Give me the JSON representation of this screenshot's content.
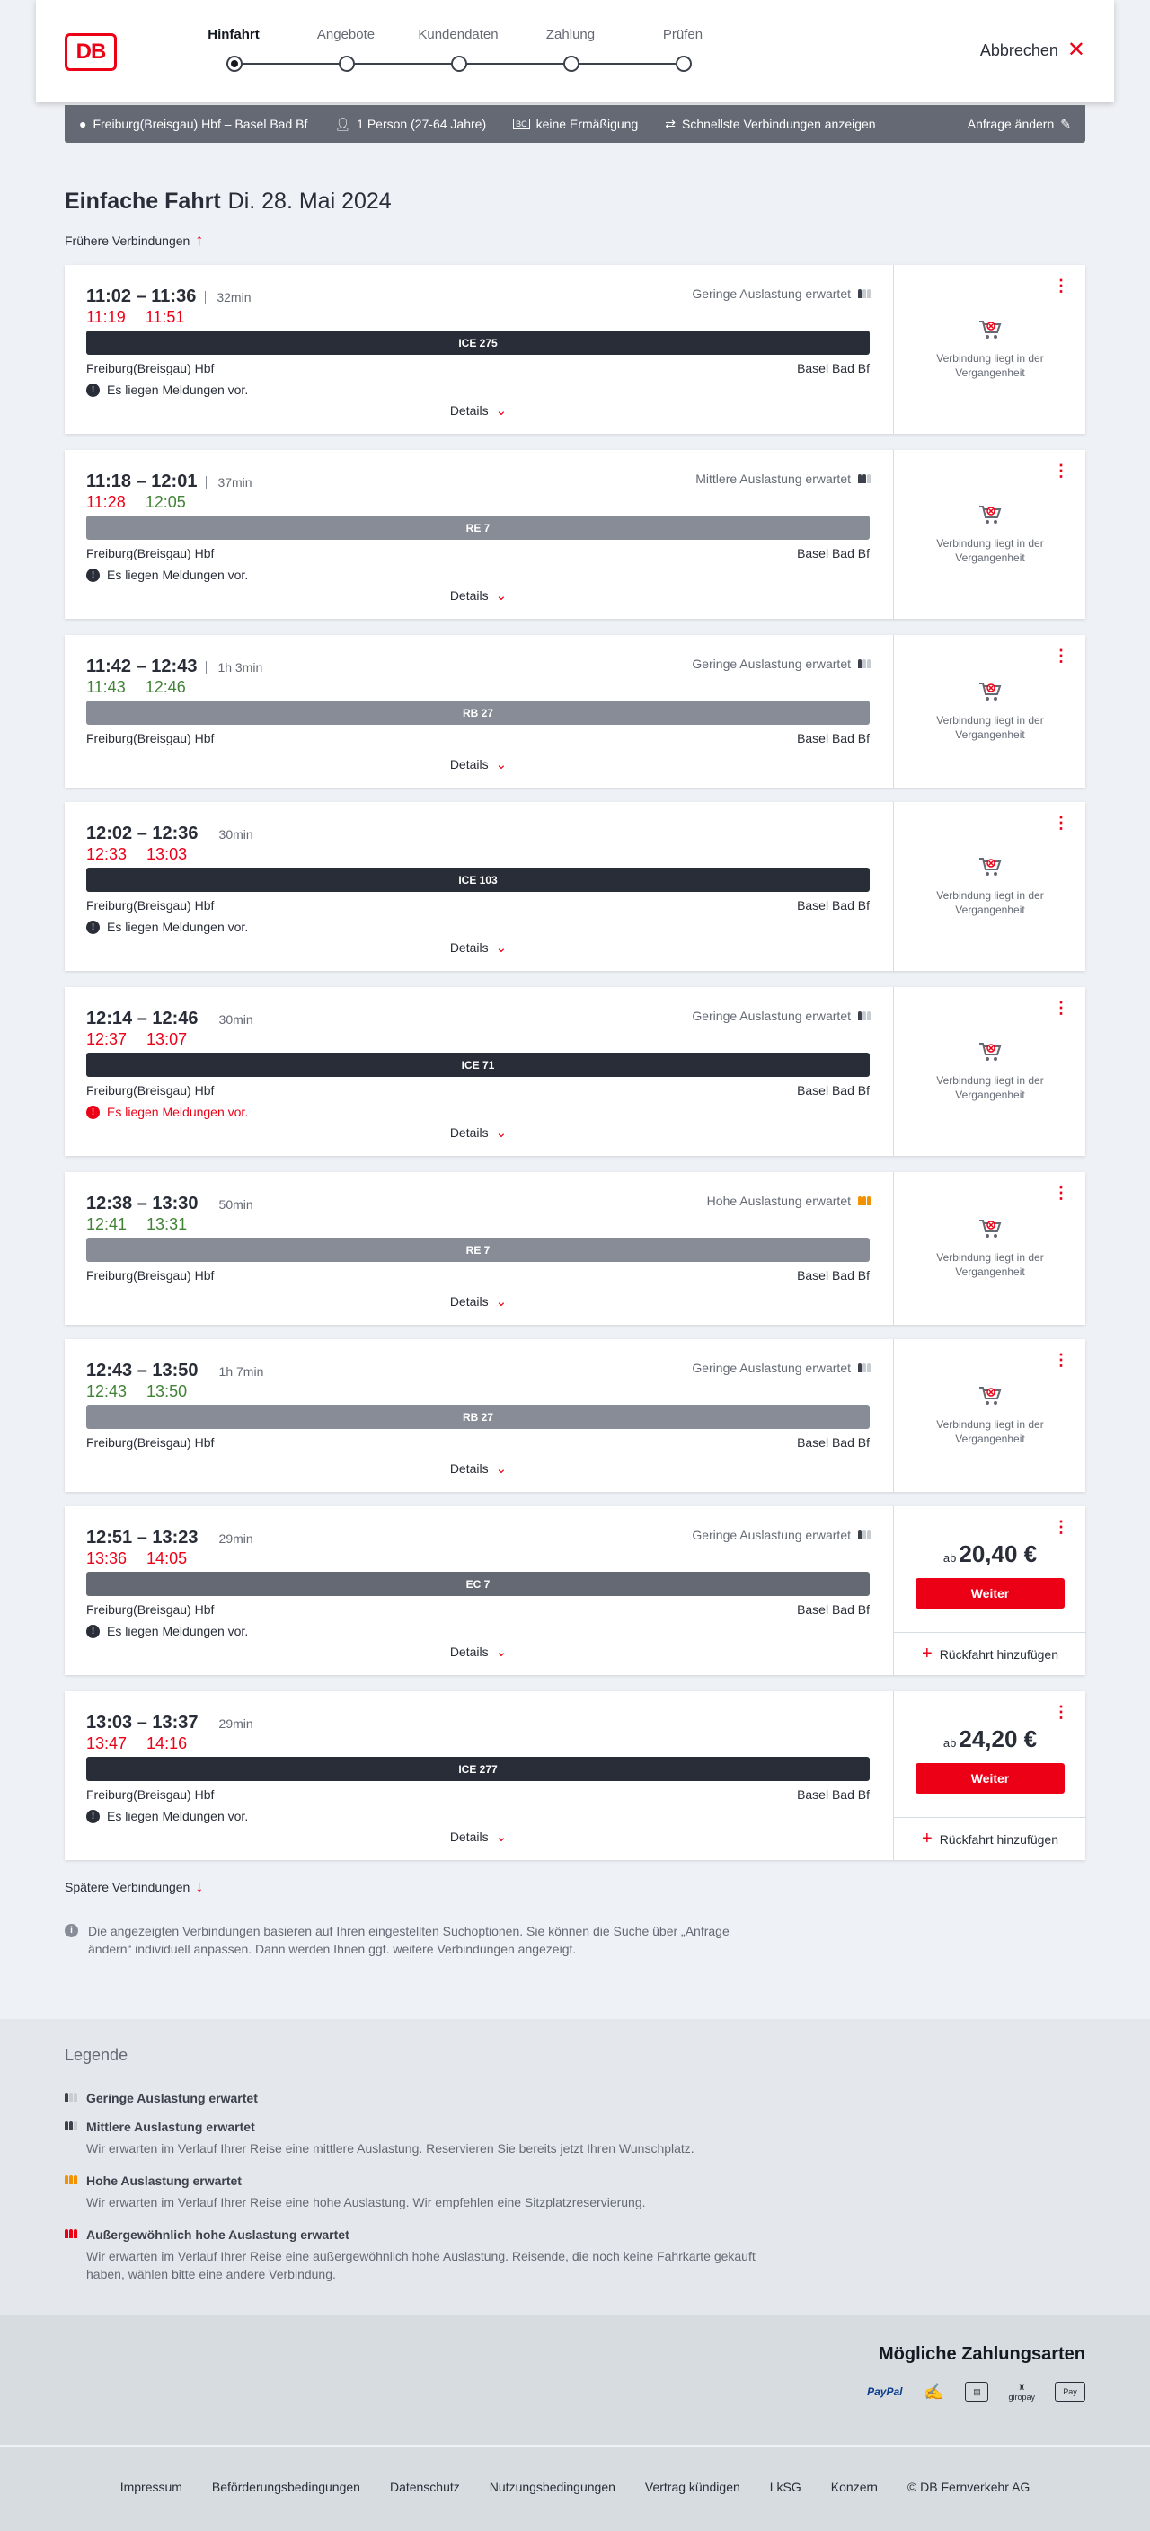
{
  "header": {
    "logo_text": "DB",
    "steps": [
      {
        "label": "Hinfahrt",
        "active": true
      },
      {
        "label": "Angebote",
        "active": false
      },
      {
        "label": "Kundendaten",
        "active": false
      },
      {
        "label": "Zahlung",
        "active": false
      },
      {
        "label": "Prüfen",
        "active": false
      }
    ],
    "cancel_label": "Abbrechen"
  },
  "summary": {
    "route": "Freiburg(Breisgau) Hbf – Basel Bad Bf",
    "travellers": "1 Person (27-64 Jahre)",
    "discount": "keine Ermäßigung",
    "fastest": "Schnellste Verbindungen anzeigen",
    "edit": "Anfrage ändern"
  },
  "page": {
    "title": "Einfache Fahrt",
    "date": "Di. 28. Mai 2024",
    "earlier": "Frühere Verbindungen",
    "later": "Spätere Verbindungen",
    "details_label": "Details",
    "past_text_1": "Verbindung liegt in der",
    "past_text_2": "Vergangenheit",
    "weiter_label": "Weiter",
    "return_label": "Rückfahrt hinzufügen",
    "price_prefix": "ab",
    "info": "Die angezeigten Verbindungen basieren auf Ihren eingestellten Suchoptionen. Sie können die Suche über „Anfrage ändern“ individuell anpassen. Dann werden Ihnen ggf. weitere Verbindungen angezeigt."
  },
  "connections": [
    {
      "time": "11:02 – 11:36",
      "duration": "32min",
      "rt_dep": "11:19",
      "rt_arr": "11:51",
      "rt_dep_late": true,
      "rt_arr_late": true,
      "load": "Geringe Auslastung erwartet",
      "train": "ICE 275",
      "from": "Freiburg(Breisgau) Hbf",
      "to": "Basel Bad Bf",
      "notice": "Es liegen Meldungen vor."
    },
    {
      "time": "11:18 – 12:01",
      "duration": "37min",
      "rt_dep": "11:28",
      "rt_arr": "12:05",
      "rt_dep_late": true,
      "rt_arr_late": false,
      "load": "Mittlere Auslastung erwartet",
      "train": "RE 7",
      "from": "Freiburg(Breisgau) Hbf",
      "to": "Basel Bad Bf",
      "notice": "Es liegen Meldungen vor."
    },
    {
      "time": "11:42 – 12:43",
      "duration": "1h 3min",
      "rt_dep": "11:43",
      "rt_arr": "12:46",
      "rt_dep_late": false,
      "rt_arr_late": false,
      "load": "Geringe Auslastung erwartet",
      "train": "RB 27",
      "from": "Freiburg(Breisgau) Hbf",
      "to": "Basel Bad Bf",
      "notice": ""
    },
    {
      "time": "12:02 – 12:36",
      "duration": "30min",
      "rt_dep": "12:33",
      "rt_arr": "13:03",
      "rt_dep_late": true,
      "rt_arr_late": true,
      "load": "",
      "train": "ICE 103",
      "from": "Freiburg(Breisgau) Hbf",
      "to": "Basel Bad Bf",
      "notice": "Es liegen Meldungen vor."
    },
    {
      "time": "12:14 – 12:46",
      "duration": "30min",
      "rt_dep": "12:37",
      "rt_arr": "13:07",
      "rt_dep_late": true,
      "rt_arr_late": true,
      "load": "Geringe Auslastung erwartet",
      "train": "ICE 71",
      "from": "Freiburg(Breisgau) Hbf",
      "to": "Basel Bad Bf",
      "notice": "Es liegen Meldungen vor."
    },
    {
      "time": "12:38 – 13:30",
      "duration": "50min",
      "rt_dep": "12:41",
      "rt_arr": "13:31",
      "rt_dep_late": false,
      "rt_arr_late": false,
      "load": "Hohe Auslastung erwartet",
      "train": "RE 7",
      "from": "Freiburg(Breisgau) Hbf",
      "to": "Basel Bad Bf",
      "notice": ""
    },
    {
      "time": "12:43 – 13:50",
      "duration": "1h 7min",
      "rt_dep": "12:43",
      "rt_arr": "13:50",
      "rt_dep_late": false,
      "rt_arr_late": false,
      "load": "Geringe Auslastung erwartet",
      "train": "RB 27",
      "from": "Freiburg(Breisgau) Hbf",
      "to": "Basel Bad Bf",
      "notice": ""
    },
    {
      "time": "12:51 – 13:23",
      "duration": "29min",
      "rt_dep": "13:36",
      "rt_arr": "14:05",
      "rt_dep_late": true,
      "rt_arr_late": true,
      "load": "Geringe Auslastung erwartet",
      "train": "EC 7",
      "from": "Freiburg(Breisgau) Hbf",
      "to": "Basel Bad Bf",
      "notice": "Es liegen Meldungen vor.",
      "price": "20,40 €"
    },
    {
      "time": "13:03 – 13:37",
      "duration": "29min",
      "rt_dep": "13:47",
      "rt_arr": "14:16",
      "rt_dep_late": true,
      "rt_arr_late": true,
      "load": "",
      "train": "ICE 277",
      "from": "Freiburg(Breisgau) Hbf",
      "to": "Basel Bad Bf",
      "notice": "Es liegen Meldungen vor.",
      "price": "24,20 €"
    }
  ],
  "legend": {
    "title": "Legende",
    "items": [
      {
        "title": "Geringe Auslastung erwartet",
        "text": ""
      },
      {
        "title": "Mittlere Auslastung erwartet",
        "text": "Wir erwarten im Verlauf Ihrer Reise eine mittlere Auslastung. Reservieren Sie bereits jetzt Ihren Wunschplatz."
      },
      {
        "title": "Hohe Auslastung erwartet",
        "text": "Wir erwarten im Verlauf Ihrer Reise eine hohe Auslastung. Wir empfehlen eine Sitzplatzreservierung."
      },
      {
        "title": "Außergewöhnlich hohe Auslastung erwartet",
        "text": "Wir erwarten im Verlauf Ihrer Reise eine außergewöhnlich hohe Auslastung. Reisende, die noch keine Fahrkarte gekauft haben, wählen bitte eine andere Verbindung."
      }
    ]
  },
  "payment": {
    "title": "Mögliche Zahlungsarten",
    "methods": [
      "PayPal",
      "giropay",
      "Pay"
    ]
  },
  "footer": {
    "links": [
      "Impressum",
      "Beförderungsbedingungen",
      "Datenschutz",
      "Nutzungsbedingungen",
      "Vertrag kündigen",
      "LkSG",
      "Konzern",
      "© DB Fernverkehr AG"
    ]
  },
  "colors": {
    "db_red": "#ec0016",
    "on_time_green": "#408335",
    "high_load_orange": "#f39200"
  }
}
